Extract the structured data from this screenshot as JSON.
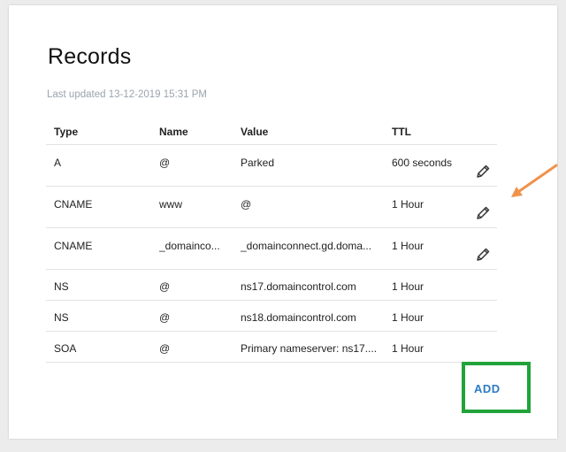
{
  "title": "Records",
  "last_updated": "Last updated 13-12-2019 15:31 PM",
  "columns": [
    "Type",
    "Name",
    "Value",
    "TTL"
  ],
  "records": [
    {
      "type": "A",
      "name": "@",
      "value": "Parked",
      "ttl": "600 seconds",
      "editable": true
    },
    {
      "type": "CNAME",
      "name": "www",
      "value": "@",
      "ttl": "1 Hour",
      "editable": true
    },
    {
      "type": "CNAME",
      "name": "_domainco...",
      "value": "_domainconnect.gd.doma...",
      "ttl": "1 Hour",
      "editable": true
    },
    {
      "type": "NS",
      "name": "@",
      "value": "ns17.domaincontrol.com",
      "ttl": "1 Hour",
      "editable": false
    },
    {
      "type": "NS",
      "name": "@",
      "value": "ns18.domaincontrol.com",
      "ttl": "1 Hour",
      "editable": false
    },
    {
      "type": "SOA",
      "name": "@",
      "value": "Primary nameserver: ns17....",
      "ttl": "1 Hour",
      "editable": false
    }
  ],
  "add_label": "ADD",
  "colors": {
    "add_text": "#2c7bc2",
    "highlight_box": "#21a33a",
    "annotation_arrow": "#f0924a"
  },
  "icons": {
    "edit": "pencil-icon",
    "annotation": "arrow-annotation"
  }
}
